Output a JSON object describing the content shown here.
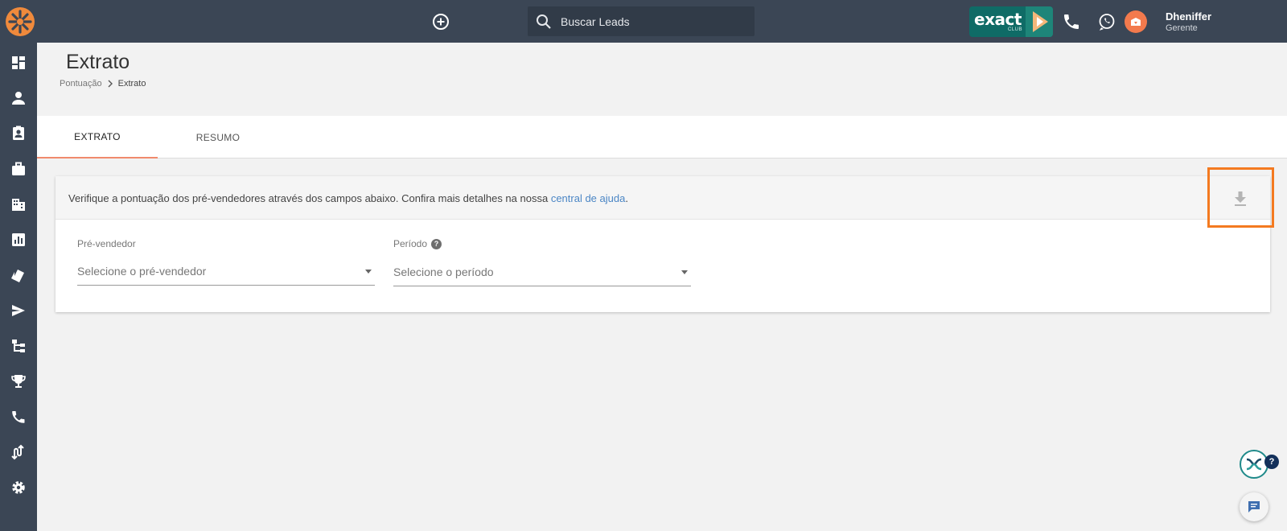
{
  "topbar": {
    "search_placeholder": "Buscar Leads",
    "brand_word": "exact",
    "brand_sub": "CLUB",
    "user_name": "Dheniffer",
    "user_role": "Gerente"
  },
  "sidebar": {
    "items": [
      {
        "icon": "dashboard-icon"
      },
      {
        "icon": "person-icon"
      },
      {
        "icon": "contact-card-icon"
      },
      {
        "icon": "briefcase-icon"
      },
      {
        "icon": "building-icon"
      },
      {
        "icon": "bar-chart-icon"
      },
      {
        "icon": "tags-icon"
      },
      {
        "icon": "send-icon"
      },
      {
        "icon": "hierarchy-icon"
      },
      {
        "icon": "trophy-icon"
      },
      {
        "icon": "phone-icon"
      },
      {
        "icon": "flow-icon"
      },
      {
        "icon": "gear-icon"
      }
    ]
  },
  "page": {
    "title": "Extrato",
    "breadcrumb_parent": "Pontuação",
    "breadcrumb_current": "Extrato"
  },
  "tabs": [
    {
      "label": "EXTRATO",
      "active": true
    },
    {
      "label": "RESUMO",
      "active": false
    }
  ],
  "info": {
    "text": "Verifique a pontuação dos pré-vendedores através dos campos abaixo. Confira mais detalhes na nossa ",
    "link": "central de ajuda",
    "suffix": "."
  },
  "filters": {
    "seller_label": "Pré-vendedor",
    "seller_placeholder": "Selecione o pré-vendedor",
    "period_label": "Período",
    "period_placeholder": "Selecione o período"
  },
  "help_badge": "?",
  "colors": {
    "topbar": "#3b4655",
    "accent": "#f08a6c",
    "highlight": "#f47a20",
    "link": "#4b86c5"
  }
}
